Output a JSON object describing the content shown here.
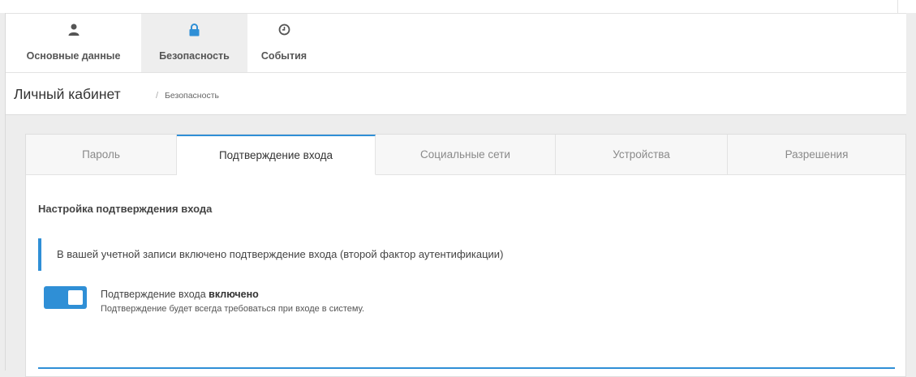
{
  "topnav": {
    "items": [
      {
        "label": "Основные данные",
        "icon": "user-icon"
      },
      {
        "label": "Безопасность",
        "icon": "lock-icon"
      },
      {
        "label": "События",
        "icon": "clock-icon"
      }
    ],
    "active_index": 1
  },
  "breadcrumb": {
    "title": "Личный кабинет",
    "separator": "/",
    "current": "Безопасность"
  },
  "tabs": {
    "items": [
      "Пароль",
      "Подтверждение входа",
      "Социальные сети",
      "Устройства",
      "Разрешения"
    ],
    "active_index": 1
  },
  "login_confirmation": {
    "section_title": "Настройка подтверждения входа",
    "notice": "В вашей учетной записи включено подтверждение входа (второй фактор аутентификации)",
    "toggle_label_prefix": "Подтверждение входа",
    "toggle_label_state": "включено",
    "toggle_on": true,
    "toggle_description": "Подтверждение будет всегда требоваться при входе в систему."
  },
  "colors": {
    "accent": "#2f8fd6",
    "icon_dark": "#555555"
  }
}
